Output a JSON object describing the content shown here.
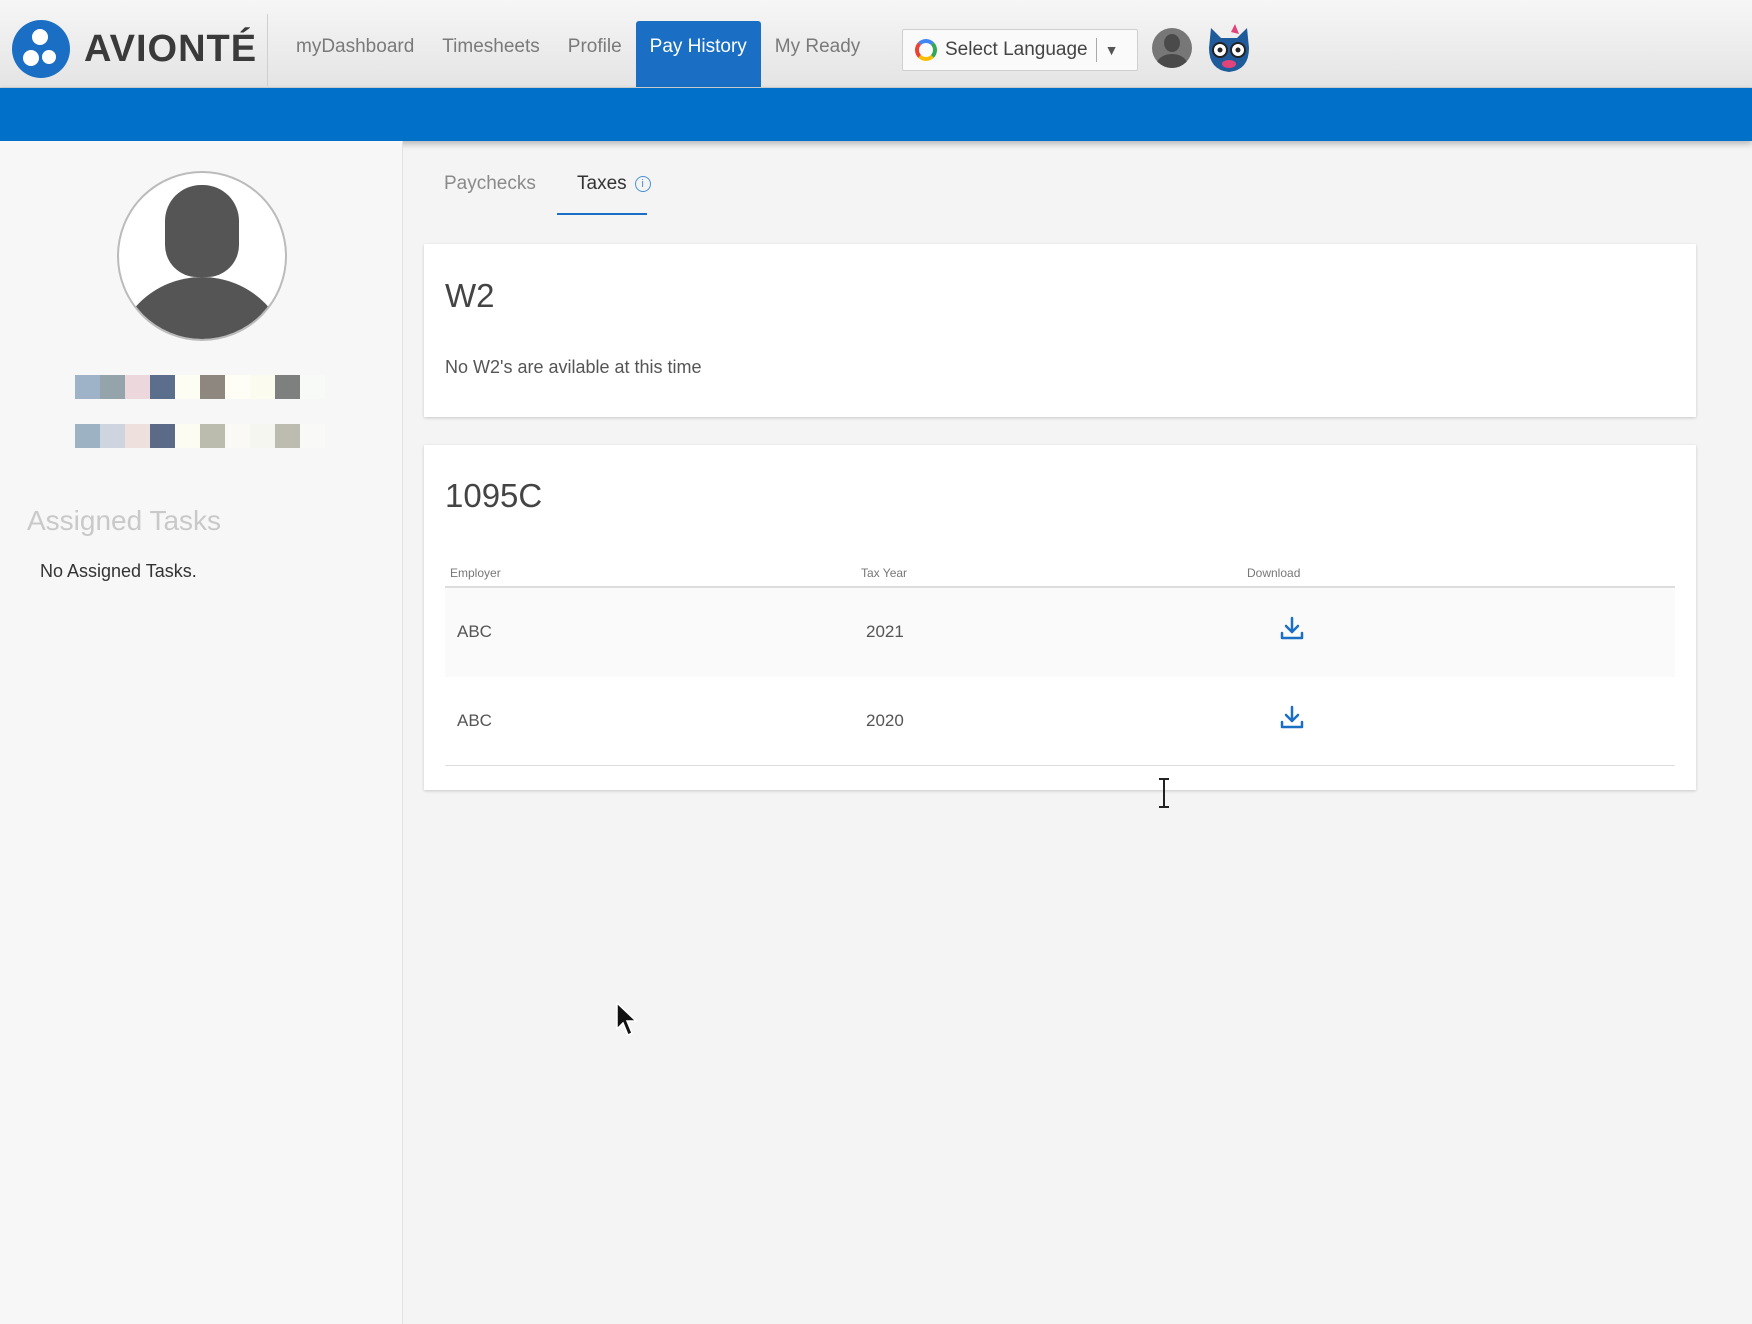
{
  "brand": {
    "name": "AVIONTÉ"
  },
  "nav": {
    "items": [
      {
        "label": "myDashboard"
      },
      {
        "label": "Timesheets"
      },
      {
        "label": "Profile"
      },
      {
        "label": "Pay History",
        "active": true
      },
      {
        "label": "My Ready"
      }
    ],
    "language": {
      "label": "Select Language",
      "arrow": "▼"
    }
  },
  "sidebar": {
    "assigned_title": "Assigned Tasks",
    "assigned_empty": "No Assigned Tasks."
  },
  "tabs": [
    {
      "label": "Paychecks"
    },
    {
      "label": "Taxes",
      "active": true,
      "info": "i"
    }
  ],
  "w2": {
    "title": "W2",
    "message": "No W2's are avilable at this time"
  },
  "form_1095c": {
    "title": "1095C",
    "columns": [
      "Employer",
      "Tax Year",
      "Download"
    ],
    "rows": [
      {
        "employer": "ABC",
        "year": "2021"
      },
      {
        "employer": "ABC",
        "year": "2020"
      }
    ]
  },
  "colors": {
    "accent": "#1a6fc4",
    "bar": "#0070c9"
  }
}
